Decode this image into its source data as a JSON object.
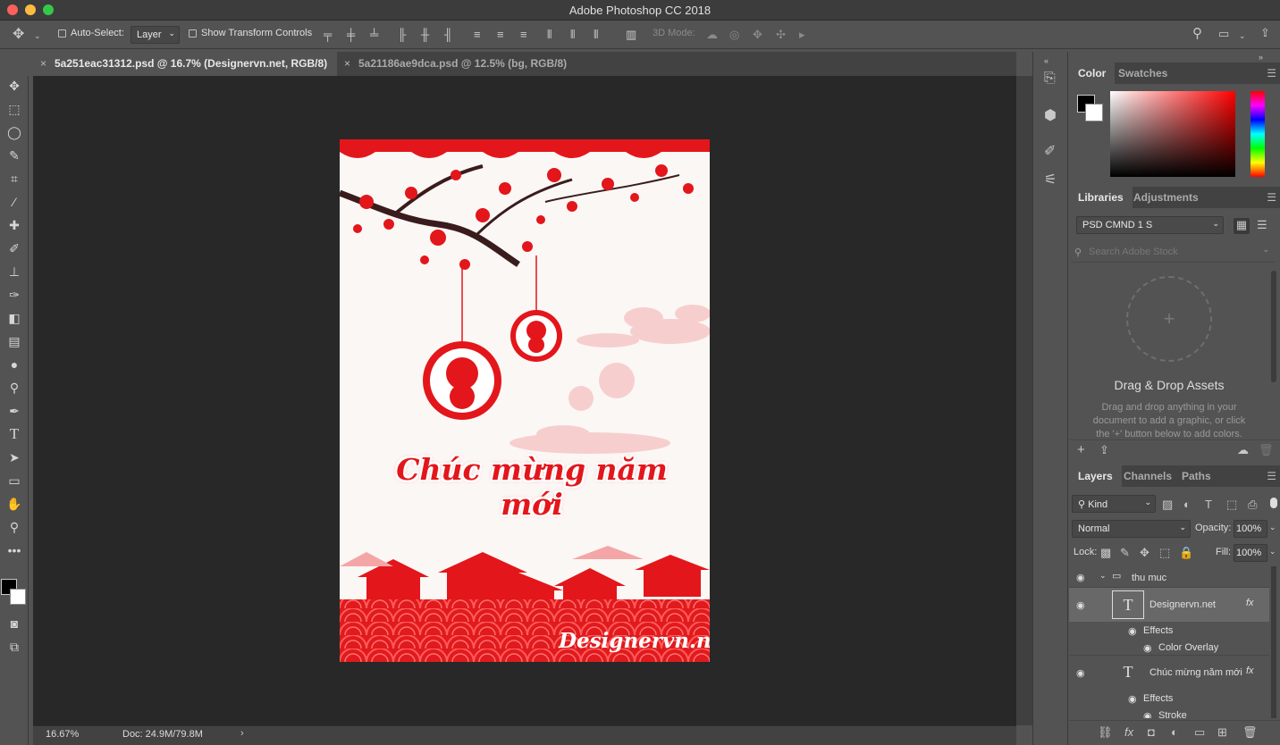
{
  "app": {
    "title": "Adobe Photoshop CC 2018"
  },
  "options": {
    "auto_select_label": "Auto-Select:",
    "auto_select_value": "Layer",
    "show_transform_label": "Show Transform Controls",
    "mode_3d_label": "3D Mode:"
  },
  "tabs": [
    {
      "label": "5a251eac31312.psd @ 16.7% (Designervn.net, RGB/8)",
      "active": true
    },
    {
      "label": "5a21186ae9dca.psd @ 12.5% (bg, RGB/8)",
      "active": false
    }
  ],
  "status": {
    "zoom": "16.67%",
    "doc": "Doc: 24.9M/79.8M"
  },
  "color_panel": {
    "tabs": [
      "Color",
      "Swatches"
    ]
  },
  "libraries": {
    "tabs": [
      "Libraries",
      "Adjustments"
    ],
    "library_name": "PSD CMND 1 S",
    "search_placeholder": "Search Adobe Stock",
    "drop_title": "Drag & Drop Assets",
    "drop_text": "Drag and drop anything in your document to add a graphic, or click the '+' button below to add colors."
  },
  "layers_panel": {
    "tabs": [
      "Layers",
      "Channels",
      "Paths"
    ],
    "kind_filter": "Kind",
    "blend_mode": "Normal",
    "opacity_label": "Opacity:",
    "opacity_value": "100%",
    "lock_label": "Lock:",
    "fill_label": "Fill:",
    "fill_value": "100%",
    "layers": [
      {
        "name": "thu muc",
        "type": "group"
      },
      {
        "name": "Designervn.net",
        "type": "text",
        "effects_label": "Effects",
        "effect": "Color Overlay"
      },
      {
        "name": "Chúc mừng năm mới",
        "type": "text",
        "effects_label": "Effects",
        "effect": "Stroke"
      }
    ]
  },
  "artwork": {
    "greeting": "Chúc mừng năm mới",
    "brand": "Designervn.net"
  },
  "colors": {
    "accent_red": "#e3161b",
    "canvas_bg": "#282828",
    "ui_bg": "#535353"
  }
}
